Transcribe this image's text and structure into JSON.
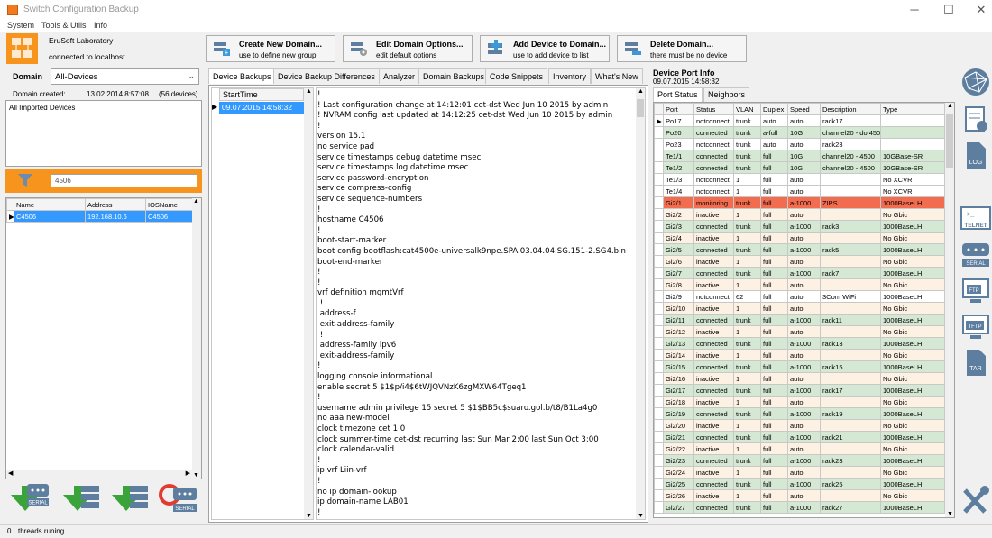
{
  "window": {
    "title": "Switch Configuration Backup",
    "min": "─",
    "max": "☐",
    "close": "✕"
  },
  "menu": [
    "System",
    "Tools & Utils",
    "Info"
  ],
  "company": {
    "name": "EruSoft Laboratory",
    "connection": "connected to localhost"
  },
  "toolbar": {
    "create": {
      "title": "Create New Domain...",
      "sub": "use to define new group"
    },
    "edit": {
      "title": "Edit Domain Options...",
      "sub": "edit default options"
    },
    "add": {
      "title": "Add Device to Domain...",
      "sub": "use to add device to list"
    },
    "delete": {
      "title": "Delete Domain...",
      "sub": "there must be no device"
    }
  },
  "domain": {
    "label": "Domain",
    "selected": "All-Devices",
    "created_label": "Domain created:",
    "created_value": "13.02.2014 8:57:08",
    "count": "(56 devices)",
    "description": "All Imported Devices"
  },
  "filter": {
    "value": "4506"
  },
  "device_list": {
    "columns": [
      "Name",
      "Address",
      "IOSName"
    ],
    "rows": [
      [
        "C4506",
        "192.168.10.6",
        "C4506"
      ]
    ]
  },
  "tabs": [
    "Device Backups",
    "Device Backup Differences",
    "Analyzer",
    "Domain Backups",
    "Code Snippets",
    "Inventory",
    "What's New"
  ],
  "backups": {
    "column": "StartTime",
    "rows": [
      "09.07.2015 14:58:32"
    ]
  },
  "config_text": [
    "!",
    "! Last configuration change at 14:12:01 cet-dst Wed Jun 10 2015 by admin",
    "! NVRAM config last updated at 14:12:25 cet-dst Wed Jun 10 2015 by admin",
    "!",
    "version 15.1",
    "no service pad",
    "service timestamps debug datetime msec",
    "service timestamps log datetime msec",
    "service password-encryption",
    "service compress-config",
    "service sequence-numbers",
    "!",
    "hostname C4506",
    "!",
    "boot-start-marker",
    "boot config bootflash:cat4500e-universalk9npe.SPA.03.04.04.SG.151-2.SG4.bin",
    "boot-end-marker",
    "!",
    "!",
    "vrf definition mgmtVrf",
    " !",
    " address-f",
    " exit-address-family",
    " !",
    " address-family ipv6",
    " exit-address-family",
    "!",
    "logging console informational",
    "enable secret 5 $1$p/i4$6tWJQVNzK6zgMXW64Tgeq1",
    "!",
    "username admin privilege 15 secret 5 $1$BB5c$suaro.gol.b/t8/B1La4g0",
    "no aaa new-model",
    "clock timezone cet 1 0",
    "clock summer-time cet-dst recurring last Sun Mar 2:00 last Sun Oct 3:00",
    "clock calendar-valid",
    "!",
    "ip vrf Liin-vrf",
    "!",
    "no ip domain-lookup",
    "ip domain-name LAB01",
    "!"
  ],
  "port_info": {
    "title": "Device Port Info",
    "timestamp": "09.07.2015 14:58:32",
    "tabs": [
      "Port Status",
      "Neighbors"
    ],
    "columns": [
      "Port",
      "Status",
      "VLAN",
      "Duplex",
      "Speed",
      "Description",
      "Type"
    ],
    "rows": [
      [
        "Po17",
        "notconnect",
        "trunk",
        "auto",
        "auto",
        "rack17",
        "",
        "white"
      ],
      [
        "Po20",
        "connected",
        "trunk",
        "a-full",
        "10G",
        "channel20 - do 450",
        "",
        "green"
      ],
      [
        "Po23",
        "notconnect",
        "trunk",
        "auto",
        "auto",
        "rack23",
        "",
        "white"
      ],
      [
        "Te1/1",
        "connected",
        "trunk",
        "full",
        "10G",
        "channel20 - 4500",
        "10GBase-SR",
        "green"
      ],
      [
        "Te1/2",
        "connected",
        "trunk",
        "full",
        "10G",
        "channel20 - 4500",
        "10GBase-SR",
        "green"
      ],
      [
        "Te1/3",
        "notconnect",
        "1",
        "full",
        "auto",
        "",
        "No XCVR",
        "white"
      ],
      [
        "Te1/4",
        "notconnect",
        "1",
        "full",
        "auto",
        "",
        "No XCVR",
        "white"
      ],
      [
        "Gi2/1",
        "monitoring",
        "trunk",
        "full",
        "a-1000",
        "ZIPS",
        "1000BaseLH",
        "red"
      ],
      [
        "Gi2/2",
        "inactive",
        "1",
        "full",
        "auto",
        "",
        "No Gbic",
        "beige"
      ],
      [
        "Gi2/3",
        "connected",
        "trunk",
        "full",
        "a-1000",
        "rack3",
        "1000BaseLH",
        "green"
      ],
      [
        "Gi2/4",
        "inactive",
        "1",
        "full",
        "auto",
        "",
        "No Gbic",
        "beige"
      ],
      [
        "Gi2/5",
        "connected",
        "trunk",
        "full",
        "a-1000",
        "rack5",
        "1000BaseLH",
        "green"
      ],
      [
        "Gi2/6",
        "inactive",
        "1",
        "full",
        "auto",
        "",
        "No Gbic",
        "beige"
      ],
      [
        "Gi2/7",
        "connected",
        "trunk",
        "full",
        "a-1000",
        "rack7",
        "1000BaseLH",
        "green"
      ],
      [
        "Gi2/8",
        "inactive",
        "1",
        "full",
        "auto",
        "",
        "No Gbic",
        "beige"
      ],
      [
        "Gi2/9",
        "notconnect",
        "62",
        "full",
        "auto",
        "3Com WiFi",
        "1000BaseLH",
        "white"
      ],
      [
        "Gi2/10",
        "inactive",
        "1",
        "full",
        "auto",
        "",
        "No Gbic",
        "beige"
      ],
      [
        "Gi2/11",
        "connected",
        "trunk",
        "full",
        "a-1000",
        "rack11",
        "1000BaseLH",
        "green"
      ],
      [
        "Gi2/12",
        "inactive",
        "1",
        "full",
        "auto",
        "",
        "No Gbic",
        "beige"
      ],
      [
        "Gi2/13",
        "connected",
        "trunk",
        "full",
        "a-1000",
        "rack13",
        "1000BaseLH",
        "green"
      ],
      [
        "Gi2/14",
        "inactive",
        "1",
        "full",
        "auto",
        "",
        "No Gbic",
        "beige"
      ],
      [
        "Gi2/15",
        "connected",
        "trunk",
        "full",
        "a-1000",
        "rack15",
        "1000BaseLH",
        "green"
      ],
      [
        "Gi2/16",
        "inactive",
        "1",
        "full",
        "auto",
        "",
        "No Gbic",
        "beige"
      ],
      [
        "Gi2/17",
        "connected",
        "trunk",
        "full",
        "a-1000",
        "rack17",
        "1000BaseLH",
        "green"
      ],
      [
        "Gi2/18",
        "inactive",
        "1",
        "full",
        "auto",
        "",
        "No Gbic",
        "beige"
      ],
      [
        "Gi2/19",
        "connected",
        "trunk",
        "full",
        "a-1000",
        "rack19",
        "1000BaseLH",
        "green"
      ],
      [
        "Gi2/20",
        "inactive",
        "1",
        "full",
        "auto",
        "",
        "No Gbic",
        "beige"
      ],
      [
        "Gi2/21",
        "connected",
        "trunk",
        "full",
        "a-1000",
        "rack21",
        "1000BaseLH",
        "green"
      ],
      [
        "Gi2/22",
        "inactive",
        "1",
        "full",
        "auto",
        "",
        "No Gbic",
        "beige"
      ],
      [
        "Gi2/23",
        "connected",
        "trunk",
        "full",
        "a-1000",
        "rack23",
        "1000BaseLH",
        "green"
      ],
      [
        "Gi2/24",
        "inactive",
        "1",
        "full",
        "auto",
        "",
        "No Gbic",
        "beige"
      ],
      [
        "Gi2/25",
        "connected",
        "trunk",
        "full",
        "a-1000",
        "rack25",
        "1000BaseLH",
        "green"
      ],
      [
        "Gi2/26",
        "inactive",
        "1",
        "full",
        "auto",
        "",
        "No Gbic",
        "beige"
      ],
      [
        "Gi2/27",
        "connected",
        "trunk",
        "full",
        "a-1000",
        "rack27",
        "1000BaseLH",
        "green"
      ]
    ]
  },
  "row_colors": {
    "white": "#ffffff",
    "green": "#d5e8d4",
    "red": "#f26c4f",
    "beige": "#fdf1e4"
  },
  "side_icons": {
    "log": "LOG",
    "telnet": "TELNET",
    "serial": "SERIAL",
    "ftp": "FTP",
    "tftp": "TFTP",
    "tar": "TAR"
  },
  "bottom_icons": {
    "serial1": "SERIAL",
    "serial2": "SERIAL"
  },
  "status": {
    "count": "0",
    "text": "threads runing"
  },
  "accent": "#f7941d"
}
